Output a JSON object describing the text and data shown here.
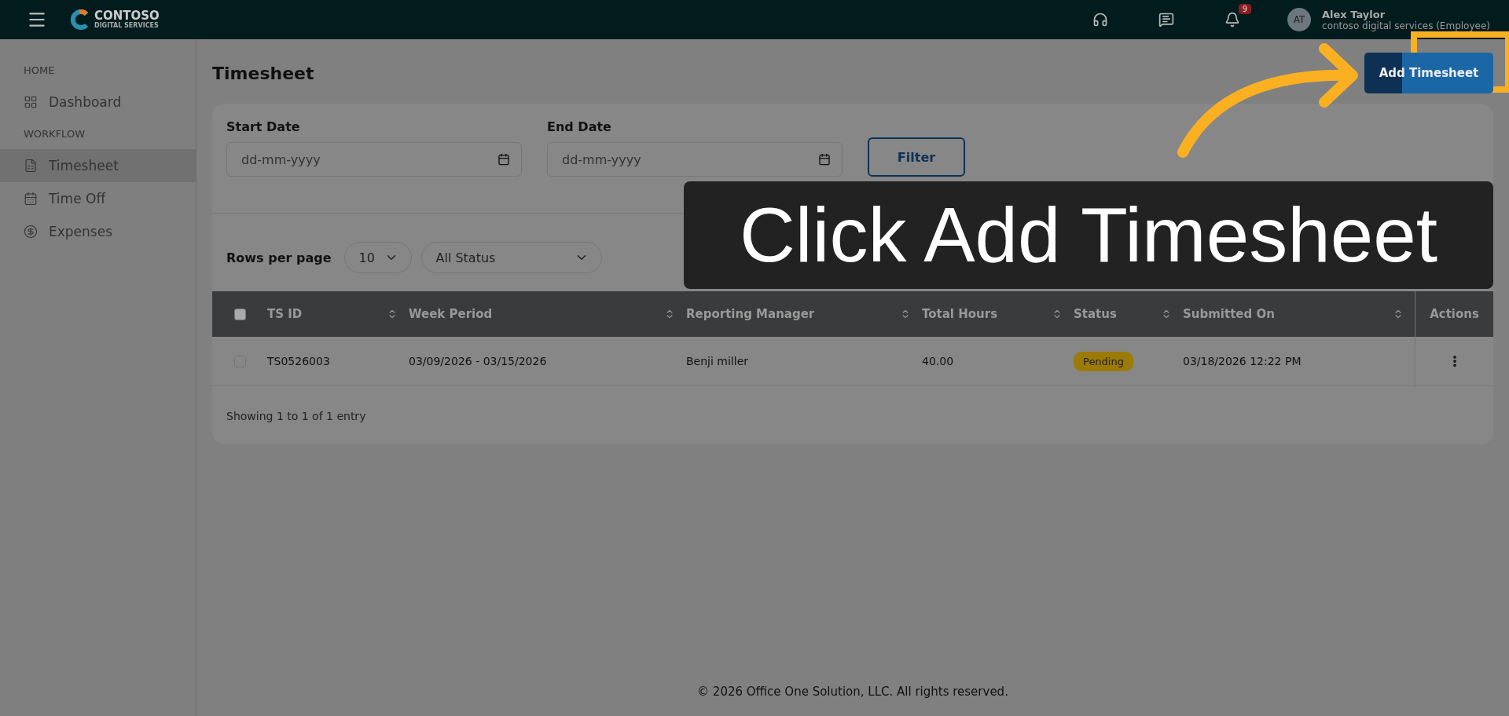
{
  "topbar": {
    "logo_text": "CONTOSO",
    "logo_subtext": "DIGITAL SERVICES",
    "notification_count": "9",
    "user": {
      "initials": "AT",
      "name": "Alex Taylor",
      "org": "contoso digital services (Employee)"
    }
  },
  "sidebar": {
    "sections": [
      {
        "heading": "HOME",
        "items": [
          {
            "label": "Dashboard",
            "selected": false
          }
        ]
      },
      {
        "heading": "WORKFLOW",
        "items": [
          {
            "label": "Timesheet",
            "selected": true
          },
          {
            "label": "Time Off",
            "selected": false
          },
          {
            "label": "Expenses",
            "selected": false
          }
        ]
      }
    ]
  },
  "page": {
    "title": "Timesheet",
    "add_button": "Add Timesheet"
  },
  "filters": {
    "start_label": "Start Date",
    "start_placeholder": "dd-mm-yyyy",
    "end_label": "End Date",
    "end_placeholder": "dd-mm-yyyy",
    "filter_button": "Filter"
  },
  "table_controls": {
    "rows_label": "Rows per page",
    "rows_value": "10",
    "status_value": "All Status"
  },
  "table": {
    "all_checked": false,
    "columns": [
      {
        "label": "TS ID",
        "kind": "sortable"
      },
      {
        "label": "Week Period",
        "kind": "sortable"
      },
      {
        "label": "Reporting Manager",
        "kind": "sortable"
      },
      {
        "label": "Total Hours",
        "kind": "sortable"
      },
      {
        "label": "Status",
        "kind": "sortable"
      },
      {
        "label": "Submitted On",
        "kind": "sortable"
      },
      {
        "label": "Actions",
        "kind": "plain"
      }
    ],
    "rows": [
      {
        "checked": false,
        "cells": [
          {
            "kind": "text",
            "text": "TS0526003"
          },
          {
            "kind": "text",
            "text": "03/09/2026 - 03/15/2026"
          },
          {
            "kind": "text",
            "text": "Benji miller"
          },
          {
            "kind": "text",
            "text": "40.00"
          },
          {
            "kind": "badge",
            "text": "Pending"
          },
          {
            "kind": "text",
            "text": "03/18/2026 12:22 PM"
          },
          {
            "kind": "menu"
          }
        ]
      }
    ],
    "summary": "Showing 1 to 1 of 1 entry"
  },
  "copyright": "© 2026 Office One Solution, LLC. All rights reserved.",
  "callout": {
    "text": "Click Add Timesheet"
  }
}
